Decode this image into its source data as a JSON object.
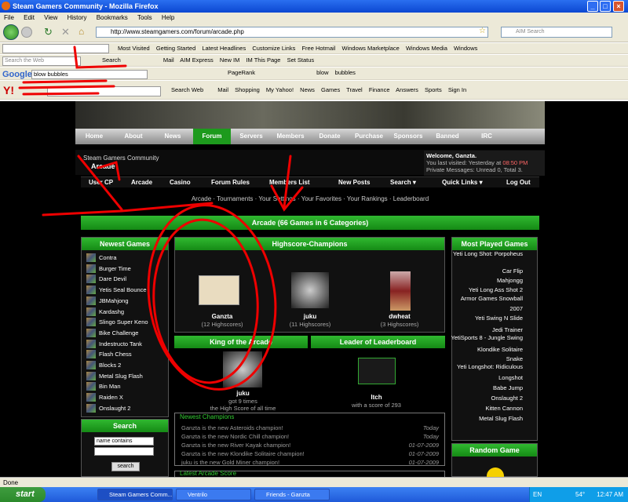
{
  "window": {
    "title": "Steam Gamers Community - Mozilla Firefox"
  },
  "menu": [
    "File",
    "Edit",
    "View",
    "History",
    "Bookmarks",
    "Tools",
    "Help"
  ],
  "address": {
    "url": "http://www.steamgamers.com/forum/arcade.php",
    "search_placeholder": "AIM Search"
  },
  "bookmarks": [
    "Most Visited",
    "Getting Started",
    "Latest Headlines",
    "Customize Links",
    "Free Hotmail",
    "Windows Marketplace",
    "Windows Media",
    "Windows"
  ],
  "aim_toolbar": {
    "search_placeholder": "Search the Web",
    "search_btn": "Search",
    "items": [
      "Mail",
      "AIM Express",
      "New IM",
      "IM This Page",
      "Set Status"
    ]
  },
  "google_toolbar": {
    "query": "blow bubbles",
    "pagerank": "PageRank",
    "words": [
      "blow",
      "bubbles"
    ]
  },
  "yahoo_toolbar": {
    "items": [
      "Search Web",
      "Mail",
      "Shopping",
      "My Yahoo!",
      "News",
      "Games",
      "Travel",
      "Finance",
      "Answers",
      "Sports",
      "Sign In"
    ]
  },
  "site": {
    "nav": [
      "Home",
      "About",
      "News",
      "Forum",
      "Servers",
      "Members",
      "Donate",
      "Purchase",
      "Sponsors",
      "Banned",
      "IRC"
    ],
    "breadcrumb": {
      "root": "Steam Gamers Community",
      "current": "Arcade"
    },
    "welcome": {
      "line1": "Welcome, Ganzta.",
      "line2": "You last visited: Yesterday at",
      "time": "08:50 PM",
      "line3": "Private Messages: Unread 0, Total 3."
    },
    "ucp_links": [
      "User CP",
      "Arcade",
      "Casino",
      "Forum Rules",
      "Members List",
      "New Posts",
      "Search ▾",
      "Quick Links ▾",
      "Log Out"
    ],
    "subnav": [
      "Arcade",
      "Tournaments",
      "Your Settings",
      "Your Favorites",
      "Your Rankings",
      "Leaderboard"
    ],
    "arcade_title": "Arcade (66 Games in 6 Categories)",
    "newest_games": {
      "title": "Newest Games",
      "items": [
        "Contra",
        "Burger Time",
        "Dare Devil",
        "Yetis Seal Bounce",
        "JBMahjong",
        "Kardashg",
        "Slingo Super Keno",
        "Bike Challenge",
        "Indestructo Tank",
        "Flash Chess",
        "Blocks 2",
        "Metal Slug Flash",
        "Bin Man",
        "Raiden X",
        "Onslaught 2"
      ]
    },
    "search_panel": {
      "title": "Search",
      "select": "name contains",
      "button": "search"
    },
    "champions": {
      "title": "Highscore-Champions",
      "people": [
        {
          "name": "Ganzta",
          "count": "12",
          "suffix": "Highscores"
        },
        {
          "name": "juku",
          "count": "11",
          "suffix": "Highscores"
        },
        {
          "name": "dwheat",
          "count": "3",
          "suffix": "Highscores"
        }
      ]
    },
    "king": {
      "title": "King of the Arcade",
      "name": "juku",
      "line1": "got 9 times",
      "line2": "the High Score of all time"
    },
    "leader": {
      "title": "Leader of Leaderboard",
      "name": "Itch",
      "line": "with a score of 293"
    },
    "newest_champions": {
      "title": "Newest Champions",
      "rows": [
        {
          "text": "Ganzta is the new Asteroids champion!",
          "date": "Today"
        },
        {
          "text": "Ganzta is the new Nordic Chill champion!",
          "date": "Today"
        },
        {
          "text": "Ganzta is the new River Kayak champion!",
          "date": "01-07-2009"
        },
        {
          "text": "Ganzta is the new Klondike Solitaire champion!",
          "date": "01-07-2009"
        },
        {
          "text": "juku is the new Gold Miner champion!",
          "date": "01-07-2009"
        }
      ]
    },
    "latest_score": {
      "title": "Latest Arcade Score"
    },
    "most_played": {
      "title": "Most Played Games",
      "items": [
        "Yeti Long Shot: Porpoheus",
        "Car Flip",
        "Mahjongg",
        "Yeti Long Ass Shot 2",
        "Armor Games Snowball",
        "2007",
        "Yeti Swing N Slide",
        "Jedi Trainer",
        "YetiSports 8 - Jungle Swing",
        "Klondike Solitaire",
        "Snake",
        "Yeti Longshot: Ridiculous",
        "Longshot",
        "Babe Jump",
        "Onslaught 2",
        "Kitten Cannon",
        "Metal Slug Flash"
      ]
    },
    "random_game": {
      "title": "Random Game"
    }
  },
  "status": "Done",
  "taskbar": {
    "start": "start",
    "tasks": [
      "Steam Gamers Comm...",
      "Ventrilo",
      "Friends - Ganzta"
    ],
    "lang": "EN",
    "temp": "54°",
    "time": "12:47 AM"
  }
}
